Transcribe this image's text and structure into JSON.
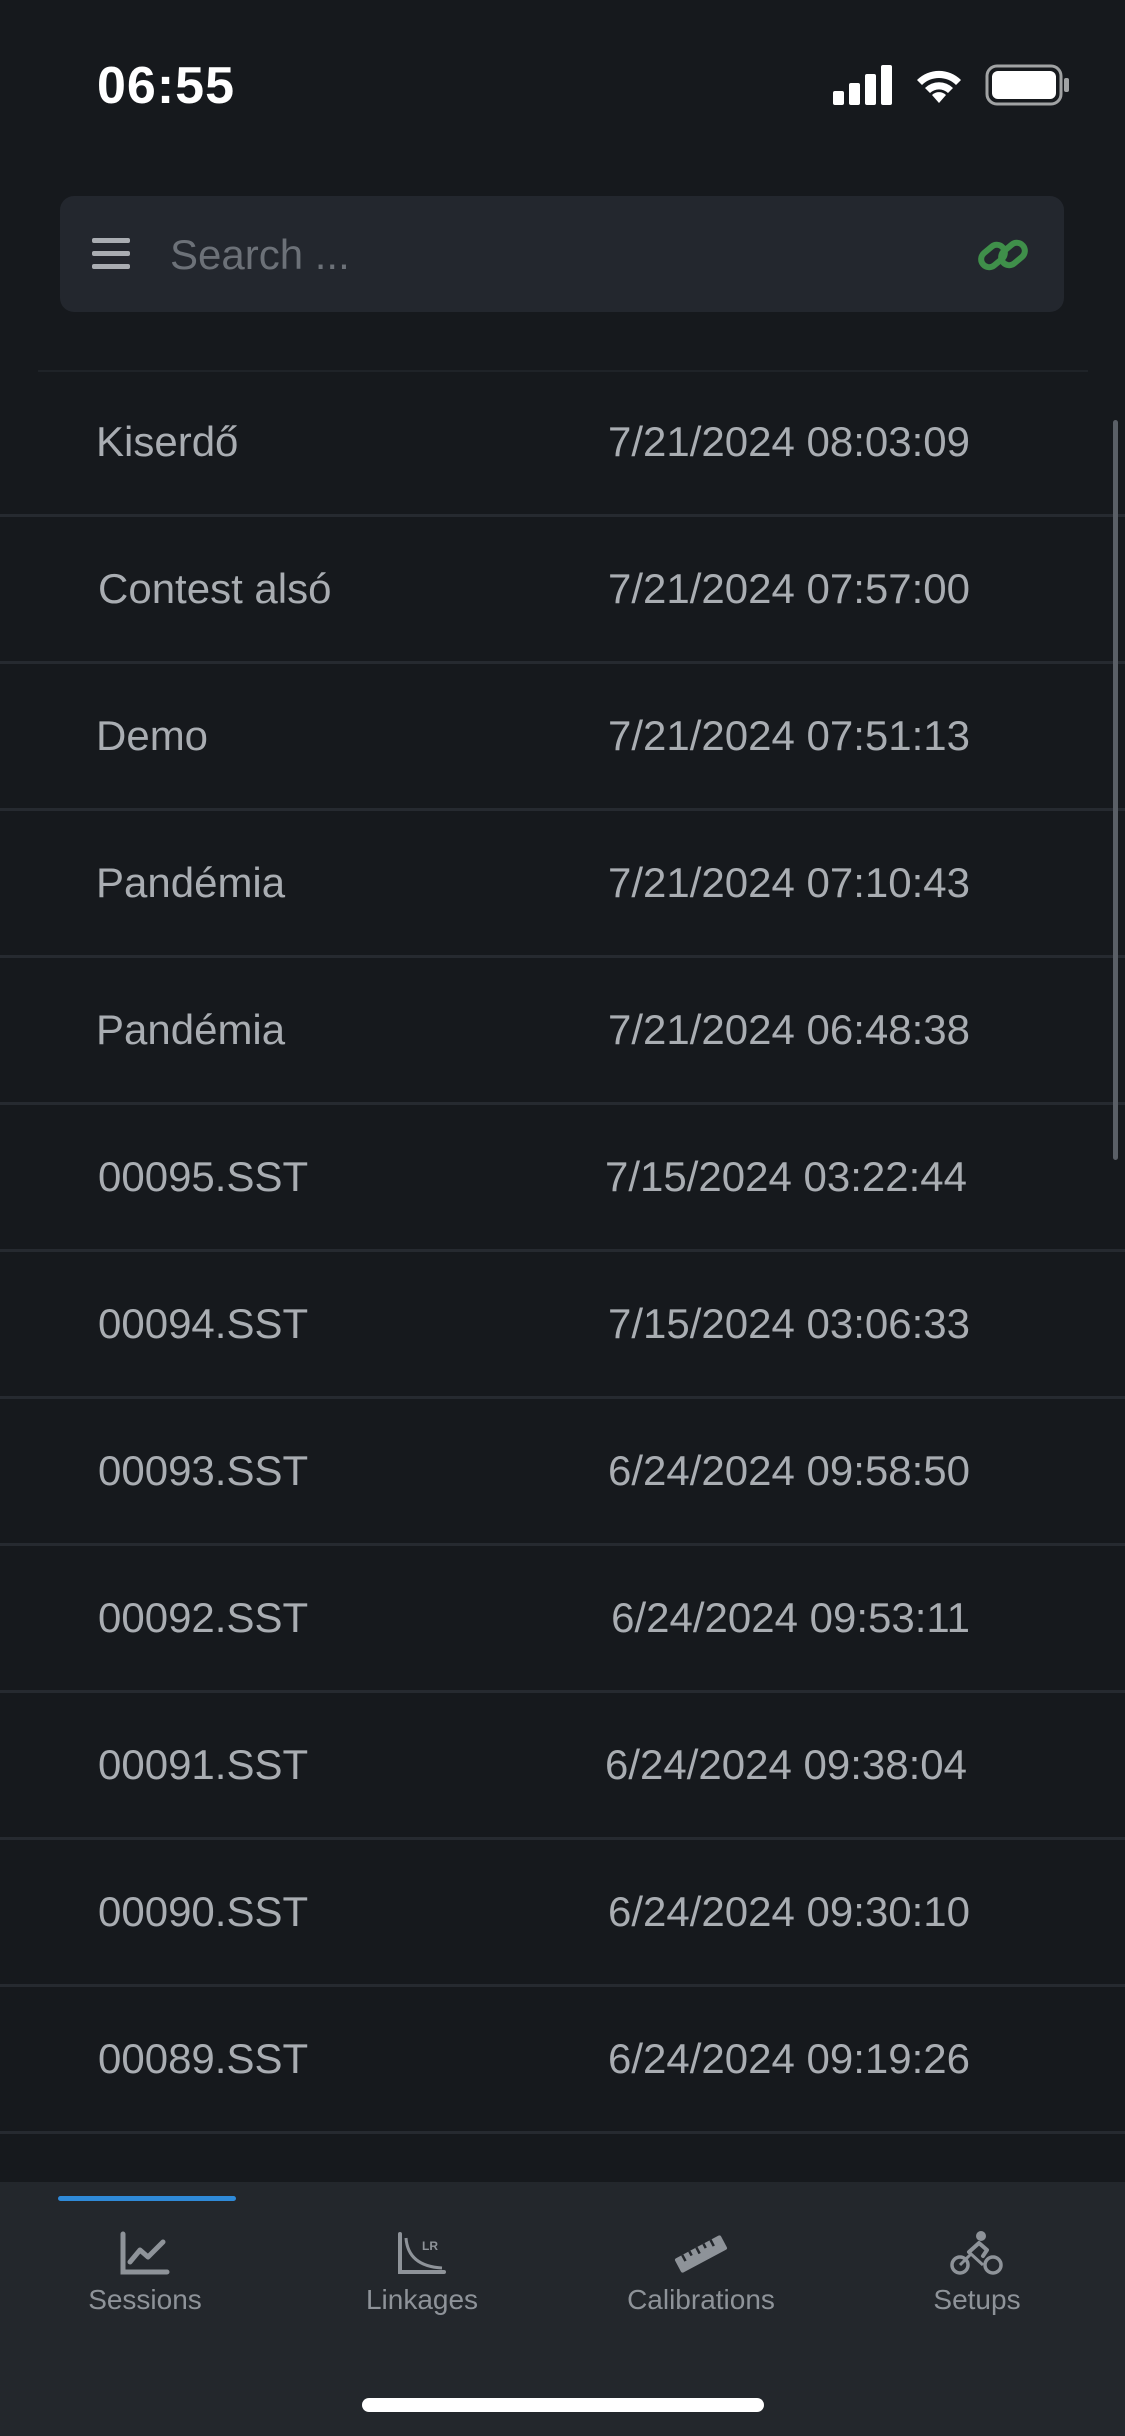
{
  "status_bar": {
    "time": "06:55"
  },
  "search": {
    "placeholder": "Search ...",
    "value": ""
  },
  "icons": {
    "menu": "hamburger-menu-icon",
    "link": "link-icon",
    "link_color": "#3f8f4a"
  },
  "sessions": [
    {
      "name": "Kiserdő",
      "date": "7/21/2024 08:03:09"
    },
    {
      "name": "Contest alsó",
      "date": "7/21/2024 07:57:00"
    },
    {
      "name": "Demo",
      "date": "7/21/2024 07:51:13"
    },
    {
      "name": "Pandémia",
      "date": "7/21/2024 07:10:43"
    },
    {
      "name": "Pandémia",
      "date": "7/21/2024 06:48:38"
    },
    {
      "name": "00095.SST",
      "date": "7/15/2024 03:22:44"
    },
    {
      "name": "00094.SST",
      "date": "7/15/2024 03:06:33"
    },
    {
      "name": "00093.SST",
      "date": "6/24/2024 09:58:50"
    },
    {
      "name": "00092.SST",
      "date": "6/24/2024 09:53:11"
    },
    {
      "name": "00091.SST",
      "date": "6/24/2024 09:38:04"
    },
    {
      "name": "00090.SST",
      "date": "6/24/2024 09:30:10"
    },
    {
      "name": "00089.SST",
      "date": "6/24/2024 09:19:26"
    }
  ],
  "tabs": [
    {
      "label": "Sessions",
      "icon": "chart-line-icon",
      "active": true
    },
    {
      "label": "Linkages",
      "icon": "leverage-ratio-icon",
      "active": false
    },
    {
      "label": "Calibrations",
      "icon": "ruler-icon",
      "active": false
    },
    {
      "label": "Setups",
      "icon": "cyclist-icon",
      "active": false
    }
  ],
  "colors": {
    "background": "#16191d",
    "accent": "#2f8ad8",
    "text": "#a9adb2"
  }
}
